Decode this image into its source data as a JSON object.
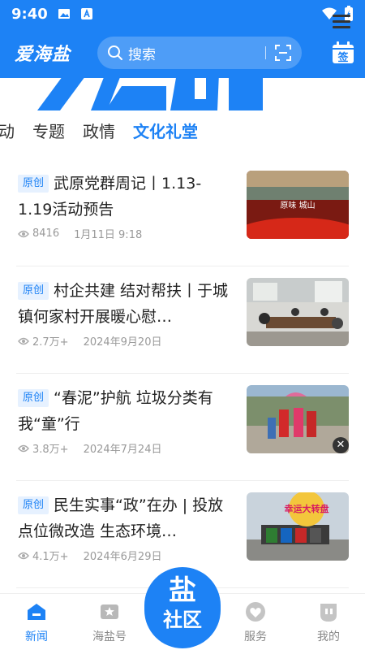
{
  "status_bar": {
    "time": "9:40"
  },
  "header": {
    "logo_text": "爱海盐",
    "search_placeholder": "搜索",
    "sign_label": "签"
  },
  "tabs": [
    {
      "label": "动",
      "active": false
    },
    {
      "label": "专题",
      "active": false
    },
    {
      "label": "政情",
      "active": false
    },
    {
      "label": "文化礼堂",
      "active": true
    }
  ],
  "news": [
    {
      "badge": "原创",
      "title": "武原党群周记丨1.13-1.19活动预告",
      "views": "8416",
      "date": "1月11日 9:18",
      "thumb_text": "原味 城山"
    },
    {
      "badge": "原创",
      "title": "村企共建 结对帮扶丨于城镇何家村开展暖心慰…",
      "views": "2.7万+",
      "date": "2024年9月20日"
    },
    {
      "badge": "原创",
      "title": "“春泥”护航 垃圾分类有我“童”行",
      "views": "3.8万+",
      "date": "2024年7月24日"
    },
    {
      "badge": "原创",
      "title": "民生实事“政”在办 | 投放点位微改造 生态环境…",
      "views": "4.1万+",
      "date": "2024年6月29日",
      "thumb_text": "幸运大转盘"
    }
  ],
  "bottom_nav": {
    "news": "新闻",
    "haiyan": "海盐号",
    "center_top": "盐",
    "center_bottom": "社区",
    "service": "服务",
    "mine": "我的"
  },
  "colors": {
    "primary": "#1d82f5",
    "badge_bg": "#e6f1ff"
  }
}
